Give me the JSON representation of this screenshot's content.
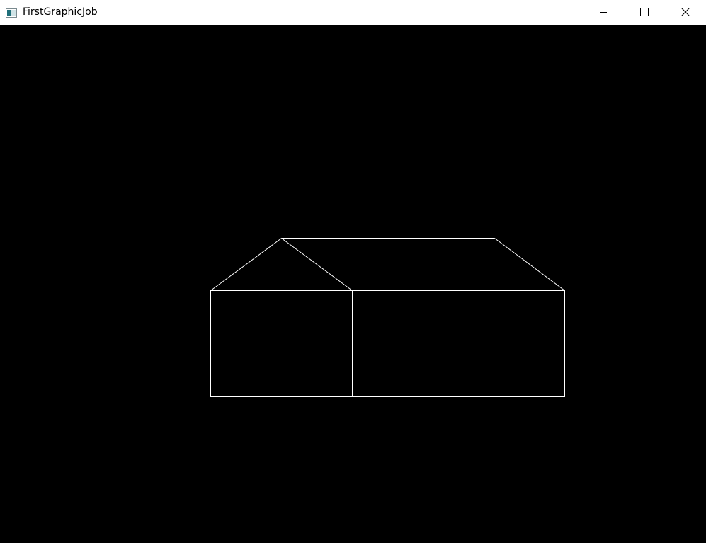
{
  "window": {
    "title": "FirstGraphicJob",
    "app_icon": "app-window-icon",
    "buttons": {
      "minimize_icon": "minimize-icon",
      "maximize_icon": "maximize-icon",
      "close_icon": "close-icon"
    }
  },
  "canvas": {
    "background_color": "#000000",
    "line_color": "#ffffff",
    "drawing": "house-wireframe"
  }
}
